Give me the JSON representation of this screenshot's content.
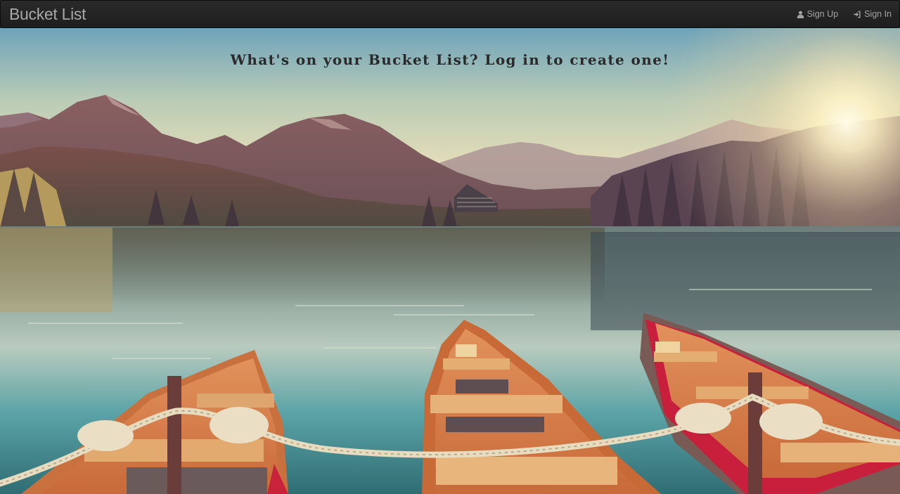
{
  "navbar": {
    "brand": "Bucket List",
    "links": [
      {
        "label": "Sign Up",
        "icon": "user-icon"
      },
      {
        "label": "Sign In",
        "icon": "sign-in-icon"
      }
    ]
  },
  "hero": {
    "headline": "What's on your Bucket List? Log in to create one!"
  },
  "colors": {
    "navbar_bg": "#222222",
    "nav_text": "#a3a3a3",
    "headline_text": "#2a2a2a"
  }
}
